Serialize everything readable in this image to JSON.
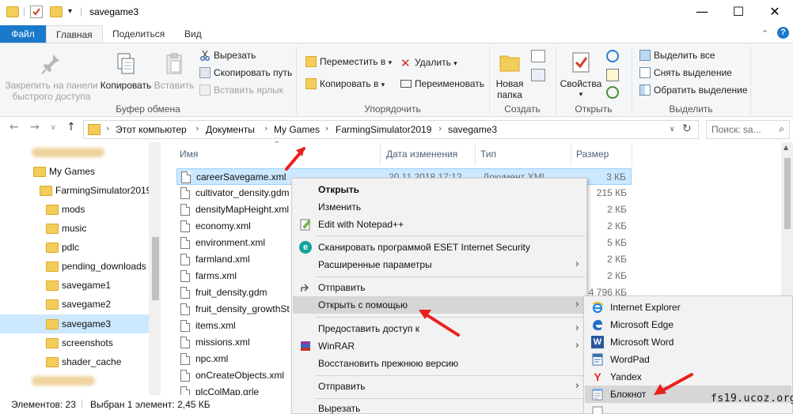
{
  "window": {
    "title": "savegame3",
    "minimize_glyph": "—",
    "maximize_glyph": "☐",
    "close_glyph": "✕"
  },
  "ribbon_tabs": [
    {
      "label": "Файл"
    },
    {
      "label": "Главная"
    },
    {
      "label": "Поделиться"
    },
    {
      "label": "Вид"
    }
  ],
  "ribbon": {
    "clipboard": {
      "pin_label_1": "Закрепить на панели",
      "pin_label_2": "быстрого доступа",
      "copy": "Копировать",
      "paste": "Вставить",
      "cut": "Вырезать",
      "copy_path": "Скопировать путь",
      "paste_shortcut": "Вставить ярлык",
      "group": "Буфер обмена"
    },
    "organize": {
      "move_to": "Переместить в",
      "copy_to": "Копировать в",
      "delete": "Удалить",
      "rename": "Переименовать",
      "group": "Упорядочить"
    },
    "create": {
      "new_folder_1": "Новая",
      "new_folder_2": "папка",
      "group": "Создать"
    },
    "open": {
      "properties": "Свойства",
      "group": "Открыть"
    },
    "select": {
      "select_all": "Выделить все",
      "select_none": "Снять выделение",
      "invert": "Обратить выделение",
      "group": "Выделить"
    }
  },
  "address": {
    "crumbs": [
      "Этот компьютер",
      "Документы",
      "My Games",
      "FarmingSimulator2019",
      "savegame3"
    ],
    "search_placeholder": "Поиск: sa..."
  },
  "nav_pane": {
    "items": [
      {
        "label": "My Games",
        "selected": false
      },
      {
        "label": "FarmingSimulator2019",
        "selected": false
      },
      {
        "label": "mods",
        "selected": false
      },
      {
        "label": "music",
        "selected": false
      },
      {
        "label": "pdlc",
        "selected": false
      },
      {
        "label": "pending_downloads",
        "selected": false
      },
      {
        "label": "savegame1",
        "selected": false
      },
      {
        "label": "savegame2",
        "selected": false
      },
      {
        "label": "savegame3",
        "selected": true
      },
      {
        "label": "screenshots",
        "selected": false
      },
      {
        "label": "shader_cache",
        "selected": false
      }
    ]
  },
  "file_list": {
    "columns": [
      "Имя",
      "Дата изменения",
      "Тип",
      "Размер"
    ],
    "rows": [
      {
        "name": "careerSavegame.xml",
        "date": "20.11.2018 17:12",
        "type": "Документ XML",
        "size": "3 КБ",
        "selected": true
      },
      {
        "name": "cultivator_density.gdm",
        "date": "",
        "type": "",
        "size": "215 КБ"
      },
      {
        "name": "densityMapHeight.xml",
        "date": "",
        "type": "",
        "size": "2 КБ"
      },
      {
        "name": "economy.xml",
        "date": "",
        "type": "",
        "size": "2 КБ"
      },
      {
        "name": "environment.xml",
        "date": "",
        "type": "",
        "size": "5 КБ"
      },
      {
        "name": "farmland.xml",
        "date": "",
        "type": "",
        "size": "2 КБ"
      },
      {
        "name": "farms.xml",
        "date": "",
        "type": "",
        "size": "2 КБ"
      },
      {
        "name": "fruit_density.gdm",
        "date": "",
        "type": "",
        "size": "4 796 КБ"
      },
      {
        "name": "fruit_density_growthSt",
        "date": "",
        "type": "",
        "size": ""
      },
      {
        "name": "items.xml",
        "date": "",
        "type": "",
        "size": ""
      },
      {
        "name": "missions.xml",
        "date": "",
        "type": "",
        "size": ""
      },
      {
        "name": "npc.xml",
        "date": "",
        "type": "",
        "size": ""
      },
      {
        "name": "onCreateObjects.xml",
        "date": "",
        "type": "",
        "size": ""
      },
      {
        "name": "plcColMap.grle",
        "date": "",
        "type": "",
        "size": ""
      }
    ]
  },
  "context_menu": {
    "items": [
      {
        "label": "Открыть",
        "bold": true
      },
      {
        "label": "Изменить"
      },
      {
        "label": "Edit with Notepad++"
      },
      {
        "label": "Сканировать программой ESET Internet Security"
      },
      {
        "label": "Расширенные параметры",
        "submenu": true
      },
      {
        "label": "Отправить"
      },
      {
        "label": "Открыть с помощью",
        "submenu": true,
        "highlighted": true
      },
      {
        "label": "Предоставить доступ к",
        "submenu": true
      },
      {
        "label": "WinRAR",
        "submenu": true
      },
      {
        "label": "Восстановить прежнюю версию"
      },
      {
        "label": "Отправить",
        "submenu": true
      },
      {
        "label": "Вырезать"
      }
    ],
    "submenu_arrow": "›"
  },
  "open_with_menu": {
    "items": [
      {
        "label": "Internet Explorer"
      },
      {
        "label": "Microsoft Edge"
      },
      {
        "label": "Microsoft Word"
      },
      {
        "label": "WordPad"
      },
      {
        "label": "Yandex"
      },
      {
        "label": "Блокнот",
        "highlighted": true
      }
    ]
  },
  "status_bar": {
    "count": "Элементов: 23",
    "selection": "Выбран 1 элемент: 2,45 КБ"
  },
  "watermark": "fs19.ucoz.org",
  "colors": {
    "accent": "#1979ca",
    "selection": "#cce8ff",
    "arrow": "#e8211d",
    "folder": "#f3cd5a"
  }
}
